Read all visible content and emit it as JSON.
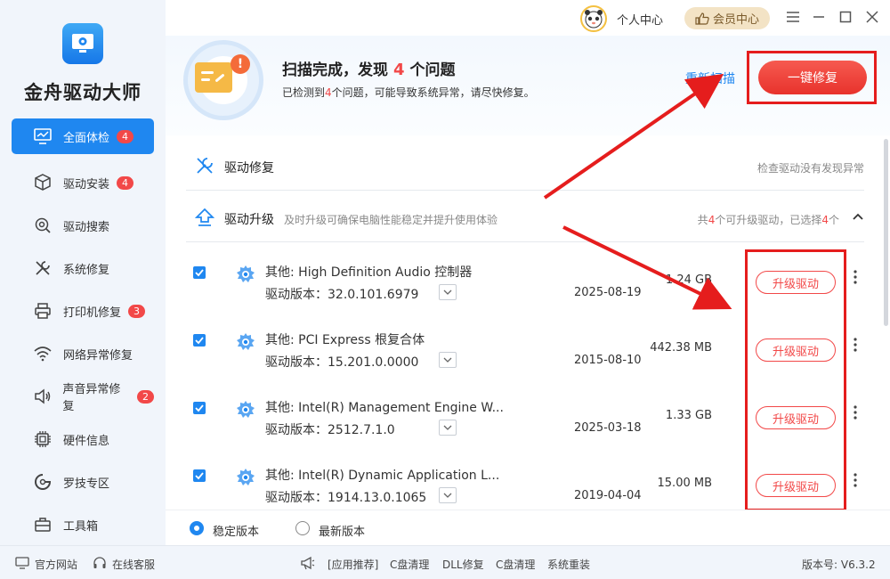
{
  "app": {
    "name": "金舟驱动大师"
  },
  "sidebar": {
    "items": [
      {
        "label": "全面体检",
        "badge": "4",
        "icon": "monitor-icon"
      },
      {
        "label": "驱动安装",
        "badge": "4",
        "icon": "box-icon"
      },
      {
        "label": "驱动搜索",
        "badge": "",
        "icon": "search-gear-icon"
      },
      {
        "label": "系统修复",
        "badge": "",
        "icon": "wrench-icon"
      },
      {
        "label": "打印机修复",
        "badge": "3",
        "icon": "printer-icon"
      },
      {
        "label": "网络异常修复",
        "badge": "",
        "icon": "wifi-icon"
      },
      {
        "label": "声音异常修复",
        "badge": "2",
        "icon": "speaker-icon"
      },
      {
        "label": "硬件信息",
        "badge": "",
        "icon": "chip-icon"
      },
      {
        "label": "罗技专区",
        "badge": "",
        "icon": "logitech-icon"
      },
      {
        "label": "工具箱",
        "badge": "",
        "icon": "toolbox-icon"
      }
    ]
  },
  "topbar": {
    "personal": "个人中心",
    "vip": "会员中心"
  },
  "header": {
    "title_prefix": "扫描完成，发现",
    "count": "4",
    "title_suffix": "个问题",
    "sub_prefix": "已检测到",
    "sub_count": "4",
    "sub_suffix": "个问题，可能导致系统异常，请尽快修复。",
    "rescan": "重新扫描",
    "fix_all": "一键修复"
  },
  "sections": {
    "repair": {
      "title": "驱动修复",
      "right": "检查驱动没有发现异常"
    },
    "upgrade": {
      "title": "驱动升级",
      "desc": "及时升级可确保电脑性能稳定并提升使用体验",
      "right_a": "共",
      "right_count": "4",
      "right_b": "个可升级驱动，已选择",
      "right_selected": "4",
      "right_c": "个"
    }
  },
  "drivers": [
    {
      "name": "其他: High Definition Audio 控制器",
      "version": "驱动版本：32.0.101.6979",
      "date": "2025-08-19",
      "size": "1.24 GB",
      "button": "升级驱动"
    },
    {
      "name": "其他: PCI Express 根复合体",
      "version": "驱动版本：15.201.0.0000",
      "date": "2015-08-10",
      "size": "442.38 MB",
      "button": "升级驱动"
    },
    {
      "name": "其他: Intel(R) Management Engine W...",
      "version": "驱动版本：2512.7.1.0",
      "date": "2025-03-18",
      "size": "1.33 GB",
      "button": "升级驱动"
    },
    {
      "name": "其他: Intel(R) Dynamic Application L...",
      "version": "驱动版本：1914.13.0.1065",
      "date": "2019-04-04",
      "size": "15.00 MB",
      "button": "升级驱动"
    }
  ],
  "version_choice": {
    "stable": "稳定版本",
    "latest": "最新版本"
  },
  "footer": {
    "official": "官方网站",
    "service": "在线客服",
    "recommend": "[应用推荐]",
    "links": [
      "C盘清理",
      "DLL修复",
      "C盘清理",
      "系统重装"
    ],
    "version": "版本号: V6.3.2"
  },
  "colors": {
    "accent": "#1f87f0",
    "danger": "#f24848",
    "annotation": "#e51d1d"
  }
}
